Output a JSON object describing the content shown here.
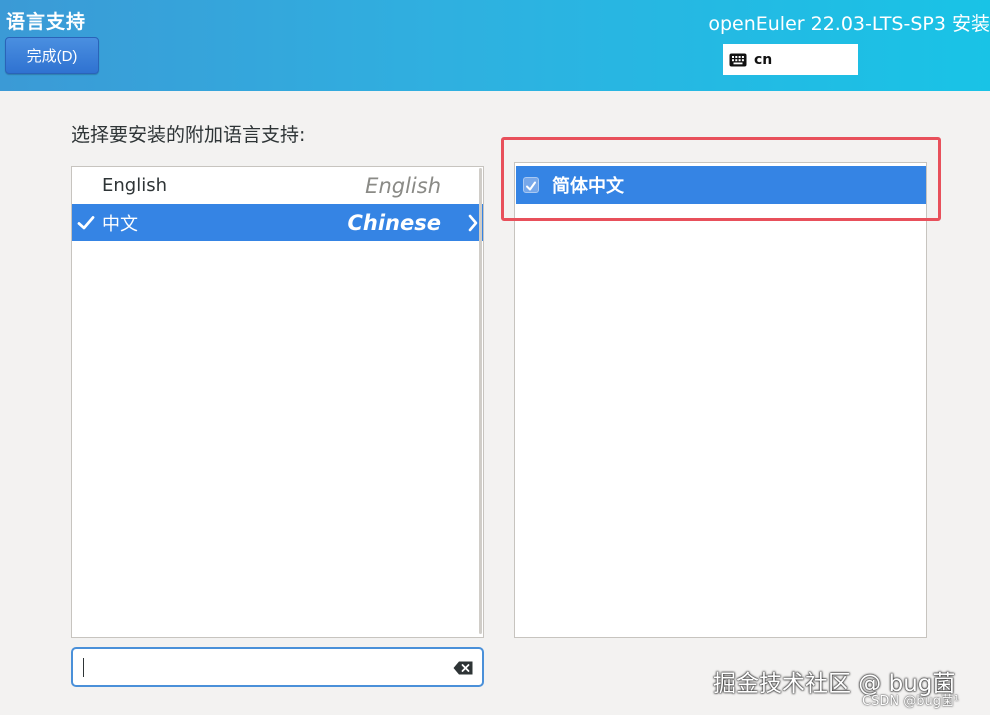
{
  "header": {
    "page_title": "语言支持",
    "done_button": "完成(D)",
    "product_title": "openEuler 22.03-LTS-SP3 安装",
    "keyboard_layout": "cn"
  },
  "main": {
    "prompt": "选择要安装的附加语言支持:",
    "languages": [
      {
        "native": "English",
        "english": "English",
        "selected": false,
        "checked": false
      },
      {
        "native": "中文",
        "english": "Chinese",
        "selected": true,
        "checked": true
      }
    ],
    "locales": [
      {
        "label": "简体中文",
        "checked": true,
        "selected": true
      }
    ],
    "search": {
      "value": "",
      "placeholder": ""
    }
  },
  "annotation": {
    "highlight_color": "#e8505b"
  },
  "watermark": {
    "line1": "掘金技术社区 @ bug菌",
    "line2": "CSDN @bug菌¹"
  },
  "colors": {
    "accent": "#3584e4",
    "header_start": "#3b9ad6",
    "header_end": "#19c3e6"
  },
  "icons": [
    "keyboard-icon",
    "checkmark-icon",
    "chevron-right-icon",
    "clear-text-icon",
    "checkbox"
  ]
}
